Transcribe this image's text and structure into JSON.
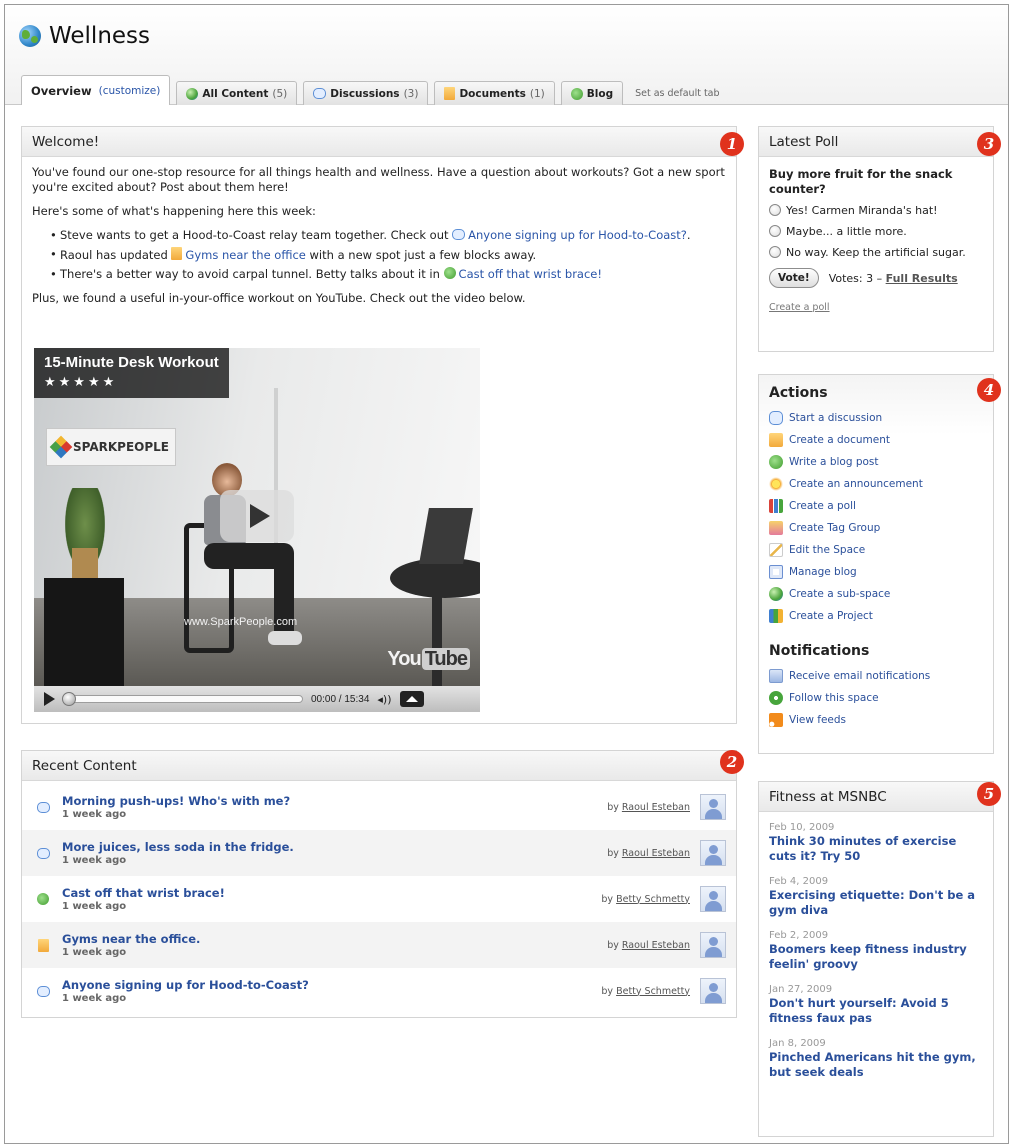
{
  "page": {
    "title": "Wellness",
    "tabs": [
      {
        "label": "Overview",
        "extra": "(customize)"
      },
      {
        "label": "All Content",
        "count": "(5)"
      },
      {
        "label": "Discussions",
        "count": "(3)"
      },
      {
        "label": "Documents",
        "count": "(1)"
      },
      {
        "label": "Blog"
      }
    ],
    "set_default": "Set as default tab"
  },
  "welcome": {
    "heading": "Welcome!",
    "badge": "1",
    "intro": "You've found our one-stop resource for all things health and wellness. Have a question about workouts? Got a new sport you're excited about? Post about them here!",
    "happening": "Here's some of what's happening here this week:",
    "bullets": [
      {
        "text": "Steve wants to get a Hood-to-Coast relay team together. Check out ",
        "link": "Anyone signing up for Hood-to-Coast?",
        "after": "."
      },
      {
        "text": "Raoul has updated ",
        "link": "Gyms near the office",
        "after": " with a new spot just a few blocks away."
      },
      {
        "text": "There's a better way to avoid carpal tunnel. Betty talks about it in ",
        "link": "Cast off that wrist brace!",
        "after": ""
      }
    ],
    "plus": "Plus, we found a useful in-your-office workout on YouTube. Check out the video below.",
    "video": {
      "title": "15-Minute Desk Workout",
      "stars": "★★★★★",
      "rating": 4.5,
      "logo_text": "SPARKPEOPLE",
      "watermark": "www.SparkPeople.com",
      "yt_you": "You",
      "yt_tube": "Tube",
      "time": "00:00 / 15:34"
    }
  },
  "recent": {
    "heading": "Recent Content",
    "badge": "2",
    "items": [
      {
        "title": "Morning push-ups! Who's with me?",
        "time": "1 week ago",
        "by": "by",
        "author": "Raoul Esteban",
        "icon": "discussion-icon"
      },
      {
        "title": "More juices, less soda in the fridge.",
        "time": "1 week ago",
        "by": "by",
        "author": "Raoul Esteban",
        "icon": "discussion-icon"
      },
      {
        "title": "Cast off that wrist brace!",
        "time": "1 week ago",
        "by": "by",
        "author": "Betty Schmetty",
        "icon": "blog-icon"
      },
      {
        "title": "Gyms near the office.",
        "time": "1 week ago",
        "by": "by",
        "author": "Raoul Esteban",
        "icon": "document-icon"
      },
      {
        "title": "Anyone signing up for Hood-to-Coast?",
        "time": "1 week ago",
        "by": "by",
        "author": "Betty Schmetty",
        "icon": "discussion-icon"
      }
    ]
  },
  "poll": {
    "heading": "Latest Poll",
    "badge": "3",
    "question": "Buy more fruit for the snack counter?",
    "options": [
      "Yes! Carmen Miranda's hat!",
      "Maybe... a little more.",
      "No way. Keep the artificial sugar."
    ],
    "vote_label": "Vote!",
    "votes_text": "Votes: 3 –",
    "results_link": "Full Results",
    "create_link": "Create a poll"
  },
  "actions": {
    "heading": "Actions",
    "badge": "4",
    "items": [
      {
        "label": "Start a discussion",
        "icon": "discussion-icon"
      },
      {
        "label": "Create a document",
        "icon": "document-icon"
      },
      {
        "label": "Write a blog post",
        "icon": "blog-icon"
      },
      {
        "label": "Create an announcement",
        "icon": "announcement-icon"
      },
      {
        "label": "Create a poll",
        "icon": "poll-icon"
      },
      {
        "label": "Create Tag Group",
        "icon": "tag-group-icon"
      },
      {
        "label": "Edit the Space",
        "icon": "edit-icon"
      },
      {
        "label": "Manage blog",
        "icon": "manage-blog-icon"
      },
      {
        "label": "Create a sub-space",
        "icon": "sub-space-icon"
      },
      {
        "label": "Create a Project",
        "icon": "project-icon"
      }
    ],
    "notifications_heading": "Notifications",
    "notifications": [
      {
        "label": "Receive email notifications",
        "icon": "email-icon"
      },
      {
        "label": "Follow this space",
        "icon": "follow-icon"
      },
      {
        "label": "View feeds",
        "icon": "rss-icon"
      }
    ]
  },
  "fitness": {
    "heading": "Fitness at MSNBC",
    "badge": "5",
    "items": [
      {
        "date": "Feb 10, 2009",
        "title": "Think 30 minutes of exercise cuts it? Try 50"
      },
      {
        "date": "Feb 4, 2009",
        "title": "Exercising etiquette: Don't be a gym diva"
      },
      {
        "date": "Feb 2, 2009",
        "title": "Boomers keep fitness industry feelin' groovy"
      },
      {
        "date": "Jan 27, 2009",
        "title": "Don't hurt yourself: Avoid 5 fitness faux pas"
      },
      {
        "date": "Jan 8, 2009",
        "title": "Pinched Americans hit the gym, but seek deals"
      }
    ]
  },
  "colors": {
    "link": "#2a55a8",
    "badge": "#e0321d",
    "panel_head": "#e9e9e9"
  }
}
